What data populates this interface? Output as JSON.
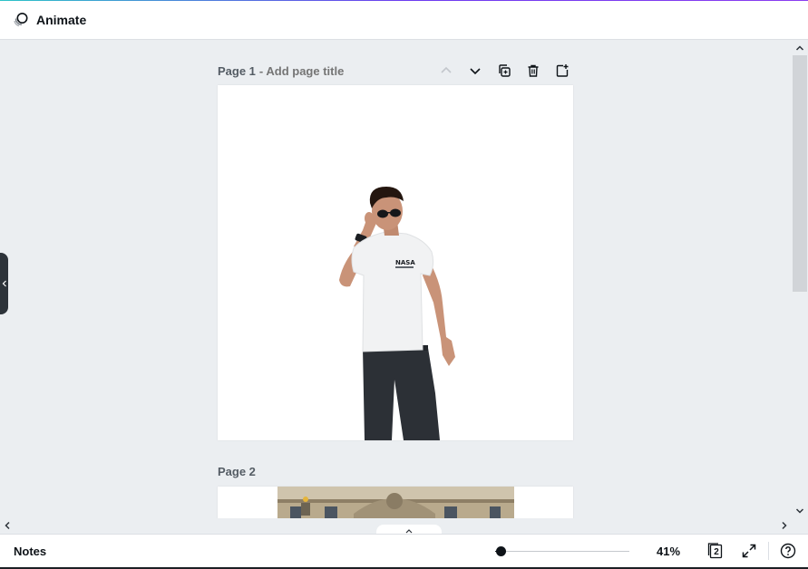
{
  "toolbar": {
    "animate_label": "Animate"
  },
  "pages": [
    {
      "label": "Page 1",
      "title_placeholder": "- Add page title"
    },
    {
      "label": "Page 2"
    }
  ],
  "footer": {
    "notes_label": "Notes",
    "zoom_percent": 41,
    "zoom_label": "41%",
    "page_count": "2"
  },
  "colors": {
    "accent_gradient": [
      "#2cc3c7",
      "#6d3df0",
      "#8b3df0"
    ],
    "canvas_bg": "#ebeef1",
    "sidebar_handle": "#2d333a"
  },
  "icons": [
    "animate-icon",
    "chevron-up-icon",
    "chevron-down-icon",
    "duplicate-page-icon",
    "trash-icon",
    "add-page-icon",
    "chevron-left-icon",
    "chevron-right-icon",
    "expand-icon",
    "help-icon",
    "page-count-icon"
  ]
}
